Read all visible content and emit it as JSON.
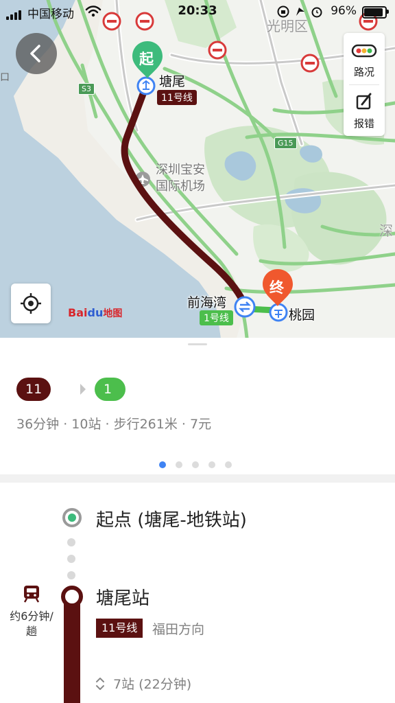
{
  "status_bar": {
    "carrier": "中国移动",
    "time": "20:33",
    "battery": "96%",
    "battery_level": 0.96
  },
  "map": {
    "district_label": "光明区",
    "district_label_right": "深",
    "airport_label_1": "深圳宝安",
    "airport_label_2": "国际机场",
    "road_labels": [
      "S3",
      "G15",
      "口"
    ],
    "start_marker": "起",
    "end_marker": "终",
    "start_station": "塘尾",
    "start_line_tag": "11号线",
    "transfer_station": "前海湾",
    "transfer_line_tag": "1号线",
    "end_station": "桃园",
    "traffic_button": "路况",
    "report_button": "报错",
    "logo_bai": "Bai",
    "logo_du": "du",
    "logo_map": "地图"
  },
  "route": {
    "chips": [
      {
        "label": "11号线",
        "color": "#5b1111"
      },
      {
        "label": "1号线",
        "color": "#4cbe4c"
      }
    ],
    "summary": "36分钟 · 10站 · 步行261米 · 7元",
    "page_count": 5,
    "active_page": 1
  },
  "steps": {
    "start_label": "起点 (塘尾-地铁站)",
    "station_title": "塘尾站",
    "line_badge": "11号线",
    "direction": "福田方向",
    "stops": "7站 (22分钟)",
    "frequency_line1": "约6分钟/",
    "frequency_line2": "趟"
  },
  "colors": {
    "line11": "#5b1111",
    "line1": "#4cbe4c",
    "start_green": "#3dbb7c",
    "end_orange": "#f0582e",
    "accent_blue": "#3f83f3"
  }
}
